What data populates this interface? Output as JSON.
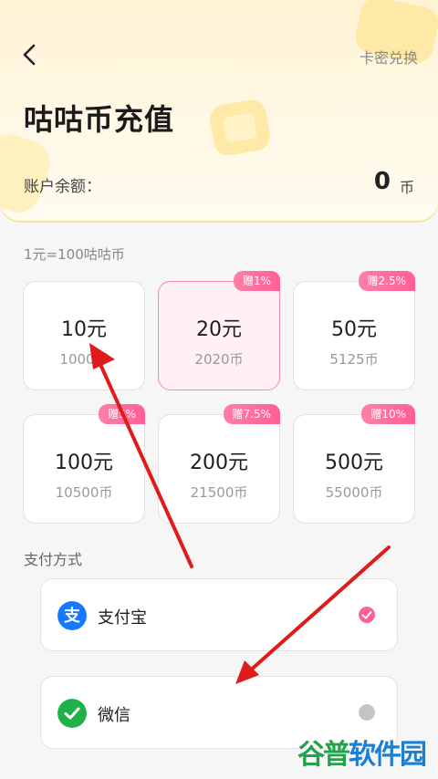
{
  "header": {
    "back_icon": "chevron-left-icon",
    "link_label": "卡密兑换",
    "title": "咕咕币充值",
    "balance_label": "账户余额：",
    "balance_value": "0",
    "balance_unit": "币"
  },
  "rate_text": "1元=100咕咕币",
  "packages": [
    {
      "amount": "10元",
      "coins": "1000币",
      "badge": "",
      "selected": false
    },
    {
      "amount": "20元",
      "coins": "2020币",
      "badge": "赠1%",
      "selected": true
    },
    {
      "amount": "50元",
      "coins": "5125币",
      "badge": "赠2.5%",
      "selected": false
    },
    {
      "amount": "100元",
      "coins": "10500币",
      "badge": "赠5%",
      "selected": false
    },
    {
      "amount": "200元",
      "coins": "21500币",
      "badge": "赠7.5%",
      "selected": false
    },
    {
      "amount": "500元",
      "coins": "55000币",
      "badge": "赠10%",
      "selected": false
    }
  ],
  "payment": {
    "label": "支付方式",
    "methods": [
      {
        "name": "支付宝",
        "icon": "alipay-icon",
        "selected": true
      },
      {
        "name": "微信",
        "icon": "wechat-icon",
        "selected": false
      }
    ]
  },
  "watermark": {
    "part1": "谷普",
    "part2": "软件园"
  },
  "colors": {
    "accent_pink": "#ff5f96",
    "alipay_blue": "#1677ff",
    "wechat_green": "#20b14a",
    "annotation_red": "#e01b1b"
  }
}
